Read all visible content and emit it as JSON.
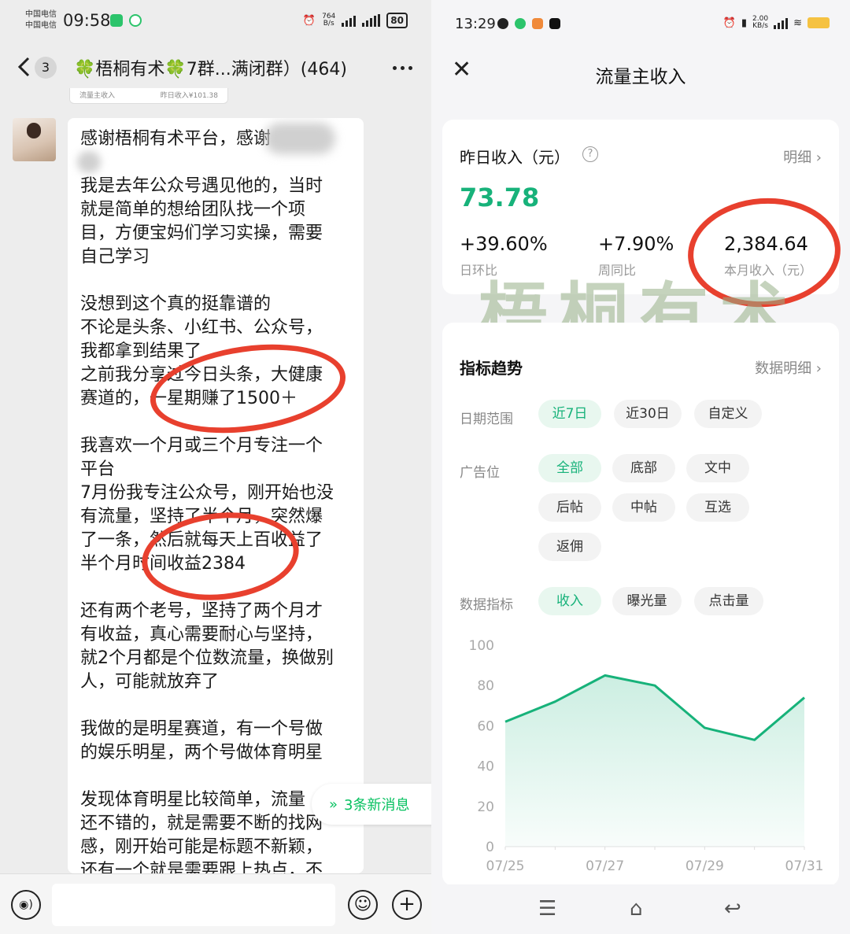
{
  "left": {
    "status": {
      "carrier1": "中国电信",
      "carrier2": "中国电信",
      "time": "09:58",
      "net_speed_top": "764",
      "net_speed_bottom": "B/s",
      "battery": "80"
    },
    "header": {
      "back_badge": "3",
      "title": "🍀梧桐有术🍀7群...满闭群）(464)"
    },
    "prev_card": {
      "left": "流量主收入",
      "right": "昨日收入¥101.38"
    },
    "message_lines": [
      "感谢梧桐有术平台，感谢",
      "",
      "我是去年公众号遇见他的，当时",
      "就是简单的想给团队找一个项",
      "目，方便宝妈们学习实操，需要",
      "自己学习",
      "",
      "没想到这个真的挺靠谱的",
      "不论是头条、小红书、公众号，",
      "我都拿到结果了",
      "之前我分享过今日头条，大健康",
      "赛道的，一星期赚了1500＋",
      "",
      "我喜欢一个月或三个月专注一个",
      "平台",
      "7月份我专注公众号，刚开始也没",
      "有流量，坚持了半个月，突然爆",
      "了一条，然后就每天上百收益了",
      "半个月时间收益2384",
      "",
      "还有两个老号，坚持了两个月才",
      "有收益，真心需要耐心与坚持，",
      "就2个月都是个位数流量，换做别",
      "人，可能就放弃了",
      "",
      "我做的是明星赛道，有一个号做",
      "的娱乐明星，两个号做体育明星",
      "",
      "发现体育明星比较简单，流量",
      "还不错的，就是需要不断的找网",
      "感，刚开始可能是标题不新颖，",
      "还有一个就是需要跟上热点，不"
    ],
    "new_messages": "3条新消息",
    "icons": [
      "voice-icon",
      "emoji-icon",
      "plus-icon"
    ]
  },
  "right": {
    "status": {
      "time": "13:29",
      "net_speed_top": "2.00",
      "net_speed_bottom": "KB/s"
    },
    "page_title": "流量主收入",
    "summary": {
      "label": "昨日收入（元）",
      "help": "?",
      "detail_link": "明细 ›",
      "value": "73.78",
      "stats": [
        {
          "value": "+39.60%",
          "label": "日环比"
        },
        {
          "value": "+7.90%",
          "label": "周同比"
        },
        {
          "value": "2,384.64",
          "label": "本月收入（元）"
        }
      ]
    },
    "watermark": "梧桐有术",
    "trend": {
      "title": "指标趋势",
      "detail_link": "数据明细 ›",
      "date_range_label": "日期范围",
      "date_range_options": [
        "近7日",
        "近30日",
        "自定义"
      ],
      "ad_slot_label": "广告位",
      "ad_slot_options": [
        "全部",
        "底部",
        "文中",
        "后帖",
        "中帖",
        "互选",
        "返佣"
      ],
      "metric_label": "数据指标",
      "metric_options": [
        "收入",
        "曝光量",
        "点击量"
      ]
    },
    "nav": [
      "menu-icon",
      "home-icon",
      "back-icon"
    ]
  },
  "colors": {
    "accent_green": "#17b27a",
    "annotation_red": "#e8402e",
    "wechat_green": "#07c160"
  },
  "chart_data": {
    "type": "area",
    "x": [
      "07/25",
      "07/26",
      "07/27",
      "07/28",
      "07/29",
      "07/30",
      "07/31"
    ],
    "x_tick_labels": [
      "07/25",
      "07/27",
      "07/29",
      "07/31"
    ],
    "series": [
      {
        "values": [
          62,
          72,
          85,
          80,
          59,
          53,
          74
        ]
      }
    ],
    "ylim": [
      0,
      100
    ],
    "y_ticks": [
      "100",
      "80",
      "60",
      "40",
      "20",
      "0"
    ],
    "color": "#17b27a",
    "grid": false
  }
}
